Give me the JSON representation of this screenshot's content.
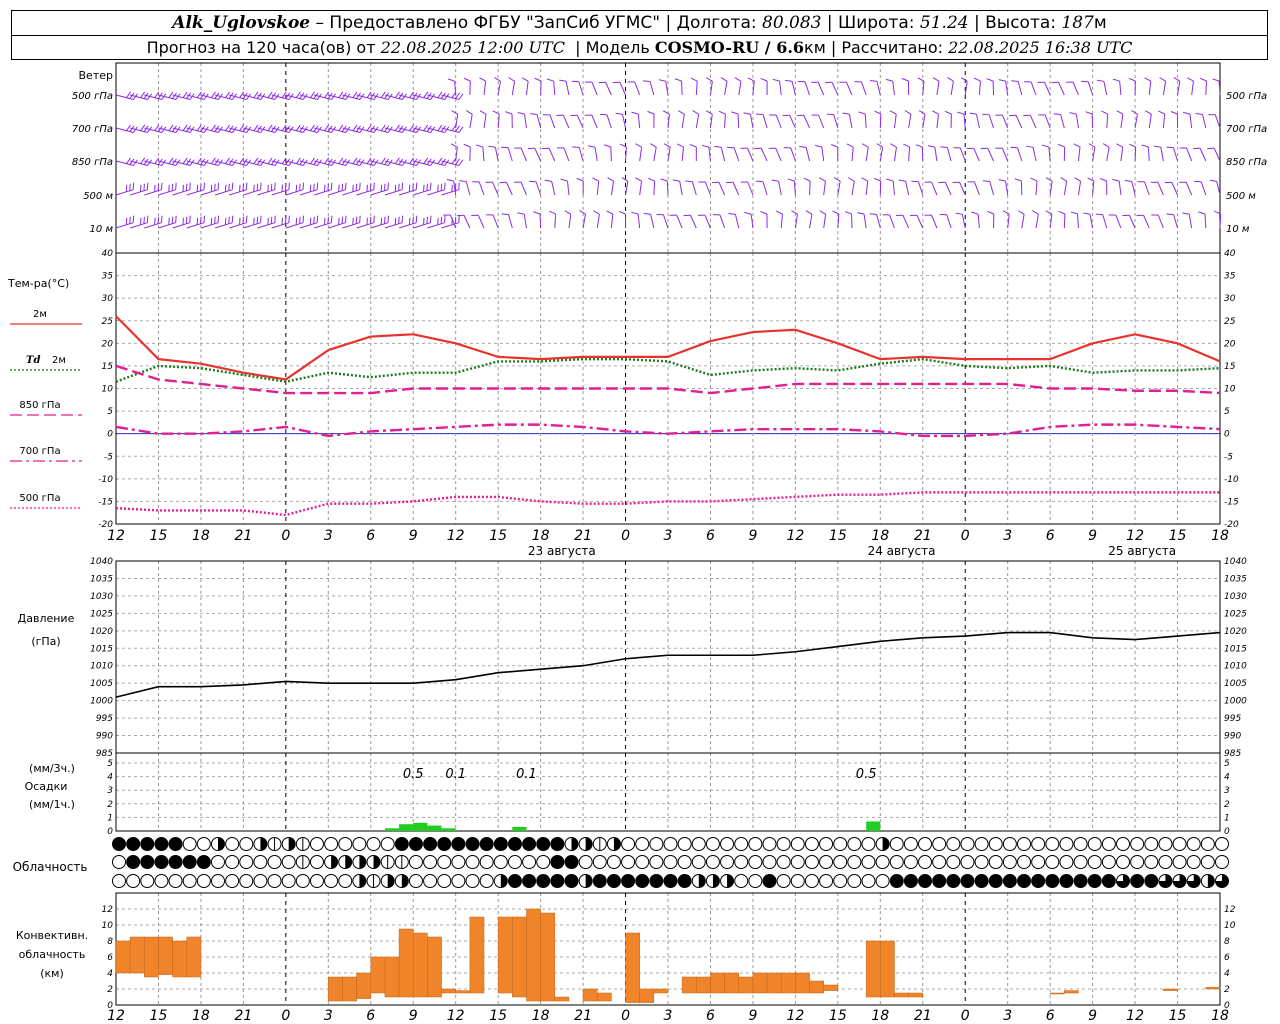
{
  "header": {
    "station": "Alk_Uglovskoe",
    "provider": "– Предоставлено ФГБУ \"ЗапСиб УГМС\"",
    "lon_label": "Долгота:",
    "lon_value": "80.083",
    "lat_label": "Широта:",
    "lat_value": "51.24",
    "alt_label": "Высота:",
    "alt_value": "187",
    "alt_unit": "м",
    "forecast_label": "Прогноз на 120 часа(ов) от",
    "forecast_start": "22.08.2025 12:00 UTC",
    "model_label": "Модель",
    "model_name": "COSMO-RU / 6.6",
    "model_unit": "км",
    "computed_label": "Рассчитано:",
    "computed_time": "22.08.2025 16:38 UTC"
  },
  "chart_data": [
    {
      "type": "wind_barbs",
      "ylabel": "Ветер",
      "levels": [
        "500 гПа",
        "700 гПа",
        "850 гПа",
        "500 м",
        "10 м"
      ],
      "color": "#8a2be2"
    },
    {
      "type": "line",
      "ylabel": "Тем-ра(°C)",
      "ylim": [
        -20,
        40
      ],
      "yticks": [
        40,
        35,
        30,
        25,
        20,
        15,
        10,
        5,
        0,
        -5,
        -10,
        -15,
        -20
      ],
      "x_hours": [
        0,
        3,
        6,
        9,
        12,
        15,
        18,
        21,
        24,
        27,
        30,
        33,
        36,
        39,
        42,
        45,
        48,
        51,
        54,
        57,
        60,
        63,
        66,
        69,
        72,
        75,
        78
      ],
      "series": [
        {
          "name": "2м",
          "color": "#e8322e",
          "style": "solid",
          "values": [
            26,
            16.5,
            15.5,
            13.5,
            12,
            18.5,
            21.5,
            22,
            20,
            17,
            16.5,
            17,
            17,
            17,
            20.5,
            22.5,
            23,
            20,
            16.5,
            17,
            16.5,
            16.5,
            16.5,
            20,
            22,
            20,
            16
          ]
        },
        {
          "name": "Td 2м",
          "color": "#1a7a1a",
          "style": "dotted",
          "values": [
            11.5,
            15,
            14.5,
            13,
            11.5,
            13.5,
            12.5,
            13.5,
            13.5,
            16,
            16,
            16.5,
            16.5,
            16,
            13,
            14,
            14.5,
            14,
            15.5,
            16.5,
            15,
            14.5,
            15,
            13.5,
            14,
            14,
            14.5
          ]
        },
        {
          "name": "850 гПа",
          "color": "#e0208e",
          "style": "dashed",
          "values": [
            15,
            12,
            11,
            10,
            9,
            9,
            9,
            10,
            10,
            10,
            10,
            10,
            10,
            10,
            9,
            10,
            11,
            11,
            11,
            11,
            11,
            11,
            10,
            10,
            9.5,
            9.5,
            9
          ]
        },
        {
          "name": "700 гПа",
          "color": "#e0208e",
          "style": "dashdot",
          "values": [
            1.5,
            0,
            0,
            0.5,
            1.5,
            -0.5,
            0.5,
            1,
            1.5,
            2,
            2,
            1.5,
            0.5,
            0,
            0.5,
            1,
            1,
            1,
            0.5,
            -0.5,
            -0.5,
            0,
            1.5,
            2,
            2,
            1.5,
            1
          ]
        },
        {
          "name": "500 гПа",
          "color": "#e0208e",
          "style": "dotted",
          "values": [
            -16.5,
            -17,
            -17,
            -17,
            -18,
            -15.5,
            -15.5,
            -15,
            -14,
            -14,
            -15,
            -15.5,
            -15.5,
            -15,
            -15,
            -14.5,
            -14,
            -13.5,
            -13.5,
            -13,
            -13,
            -13,
            -13,
            -13,
            -13,
            -13,
            -13
          ]
        }
      ]
    },
    {
      "type": "line",
      "ylabel": "Давление",
      "yunit": "(гПа)",
      "ylim": [
        985,
        1040
      ],
      "yticks": [
        1040,
        1035,
        1030,
        1025,
        1020,
        1015,
        1010,
        1005,
        1000,
        995,
        990,
        985
      ],
      "series": [
        {
          "name": "",
          "color": "#000000",
          "values": [
            1001,
            1004,
            1004,
            1004.5,
            1005.5,
            1005,
            1005,
            1005,
            1006,
            1008,
            1009,
            1010,
            1012,
            1013,
            1013,
            1013,
            1014,
            1015.5,
            1017,
            1018,
            1018.5,
            1019.5,
            1019.5,
            1018,
            1017.5,
            1018.5,
            1019.5
          ]
        }
      ]
    },
    {
      "type": "bar",
      "ylabel": "Осадки",
      "yunit_top": "(мм/3ч.)",
      "yunit_bottom": "(мм/1ч.)",
      "ylim": [
        0,
        5
      ],
      "yticks": [
        5,
        4,
        3,
        2,
        1,
        0
      ],
      "labels": [
        {
          "hour": 21,
          "text": "0.5"
        },
        {
          "hour": 24,
          "text": "0.1"
        },
        {
          "hour": 29,
          "text": "0.1"
        },
        {
          "hour": 53,
          "text": "0.5"
        }
      ],
      "bars_hours": [
        19,
        20,
        21,
        22,
        23,
        28,
        53
      ],
      "bars_values": [
        0.2,
        0.5,
        0.6,
        0.4,
        0.2,
        0.3,
        0.7
      ],
      "color": "#22cc22"
    },
    {
      "type": "table",
      "ylabel": "Облачность",
      "rows": 3,
      "columns": 79,
      "note": "high / middle / low cloud fraction symbols, values 0–8 octas",
      "high": [
        8,
        8,
        8,
        8,
        8,
        0,
        0,
        4,
        0,
        0,
        4,
        2,
        4,
        2,
        0,
        0,
        0,
        0,
        0,
        0,
        8,
        8,
        8,
        8,
        8,
        8,
        8,
        8,
        8,
        8,
        8,
        8,
        4,
        4,
        2,
        4,
        0,
        0,
        0,
        0,
        0,
        0,
        0,
        0,
        0,
        0,
        0,
        0,
        0,
        0,
        0,
        0,
        0,
        0,
        4,
        0,
        0,
        0,
        0,
        0,
        0,
        0,
        0,
        0,
        0,
        0,
        0,
        0,
        0,
        0,
        0,
        0,
        0,
        0,
        0,
        0,
        0,
        0,
        0
      ],
      "middle": [
        0,
        8,
        8,
        8,
        8,
        8,
        8,
        0,
        0,
        0,
        0,
        0,
        0,
        2,
        0,
        4,
        4,
        4,
        4,
        2,
        2,
        0,
        0,
        0,
        0,
        0,
        0,
        0,
        0,
        0,
        0,
        8,
        8,
        0,
        0,
        0,
        0,
        0,
        0,
        0,
        0,
        0,
        0,
        0,
        0,
        0,
        0,
        0,
        0,
        0,
        0,
        0,
        0,
        0,
        0,
        0,
        0,
        0,
        0,
        0,
        0,
        0,
        0,
        0,
        0,
        0,
        0,
        0,
        0,
        0,
        0,
        0,
        0,
        0,
        0,
        0,
        0,
        0,
        0
      ],
      "low": [
        0,
        0,
        0,
        0,
        0,
        0,
        0,
        0,
        0,
        0,
        0,
        0,
        0,
        0,
        0,
        0,
        0,
        4,
        2,
        4,
        4,
        0,
        0,
        0,
        0,
        0,
        0,
        4,
        8,
        8,
        8,
        8,
        8,
        4,
        8,
        8,
        8,
        8,
        8,
        8,
        8,
        4,
        4,
        4,
        0,
        0,
        8,
        0,
        0,
        0,
        0,
        0,
        0,
        0,
        0,
        8,
        8,
        8,
        8,
        8,
        8,
        8,
        8,
        8,
        8,
        8,
        8,
        8,
        8,
        8,
        8,
        6,
        8,
        8,
        6,
        6,
        6,
        4,
        6
      ]
    },
    {
      "type": "bar",
      "ylabel": "Конвективн. облачность (км)",
      "ylim": [
        0,
        14
      ],
      "yticks": [
        12,
        10,
        8,
        6,
        4,
        2,
        0
      ],
      "x_hours": [
        0.5,
        1.5,
        2.5,
        3.5,
        4.5,
        5.5,
        15.5,
        16.5,
        17.5,
        18.5,
        19.5,
        20.5,
        21.5,
        22.5,
        23.5,
        24.5,
        25.5,
        27.5,
        28.5,
        29.5,
        30.5,
        31.5,
        33.5,
        34.5,
        36.5,
        37.5,
        38.5,
        40.5,
        41.5,
        42.5,
        43.5,
        44.5,
        45.5,
        46.5,
        47.5,
        48.5,
        49.5,
        50.5,
        53.5,
        54.5,
        55.5,
        56.5,
        66.5,
        67.5,
        74.5,
        77.5
      ],
      "bottoms": [
        4,
        4,
        3.5,
        3.8,
        3.5,
        3.5,
        0.5,
        0.5,
        0.8,
        1.5,
        1,
        1,
        1,
        1,
        1.5,
        1.5,
        1.5,
        1.5,
        1,
        0.5,
        0.5,
        0.5,
        0.5,
        0.5,
        0.3,
        0.3,
        1.5,
        1.5,
        1.5,
        1.5,
        1.5,
        1.5,
        1.5,
        1.5,
        1.5,
        1.5,
        1.5,
        1.8,
        1,
        1,
        1,
        1,
        1.5,
        1.5,
        1.8,
        2
      ],
      "tops": [
        8,
        8.5,
        8.5,
        8.5,
        8,
        8.5,
        3.5,
        3.5,
        4,
        6,
        6,
        9.5,
        9,
        8.5,
        2,
        1.8,
        11,
        11,
        11,
        12,
        11.5,
        1,
        2,
        1.5,
        9,
        2,
        2,
        3.5,
        3.5,
        4,
        4,
        3.5,
        4,
        4,
        4,
        4,
        3,
        2.5,
        8,
        8,
        1.5,
        1.5,
        1.5,
        1.8,
        2,
        2.2
      ],
      "color": "#f0842a"
    }
  ],
  "axis": {
    "hour_labels": [
      "12",
      "15",
      "18",
      "21",
      "0",
      "3",
      "6",
      "9",
      "12",
      "15",
      "18",
      "21",
      "0",
      "3",
      "6",
      "9",
      "12",
      "15",
      "18",
      "21",
      "0",
      "3",
      "6",
      "9",
      "12",
      "15",
      "18"
    ],
    "day_labels": [
      "23 августа",
      "24 августа",
      "25 августа"
    ]
  },
  "legend": {
    "t2m": "2м",
    "td_prefix": "Td",
    "td_suffix": "2м",
    "t850": "850 гПа",
    "t700": "700 гПа",
    "t500": "500 гПа"
  }
}
